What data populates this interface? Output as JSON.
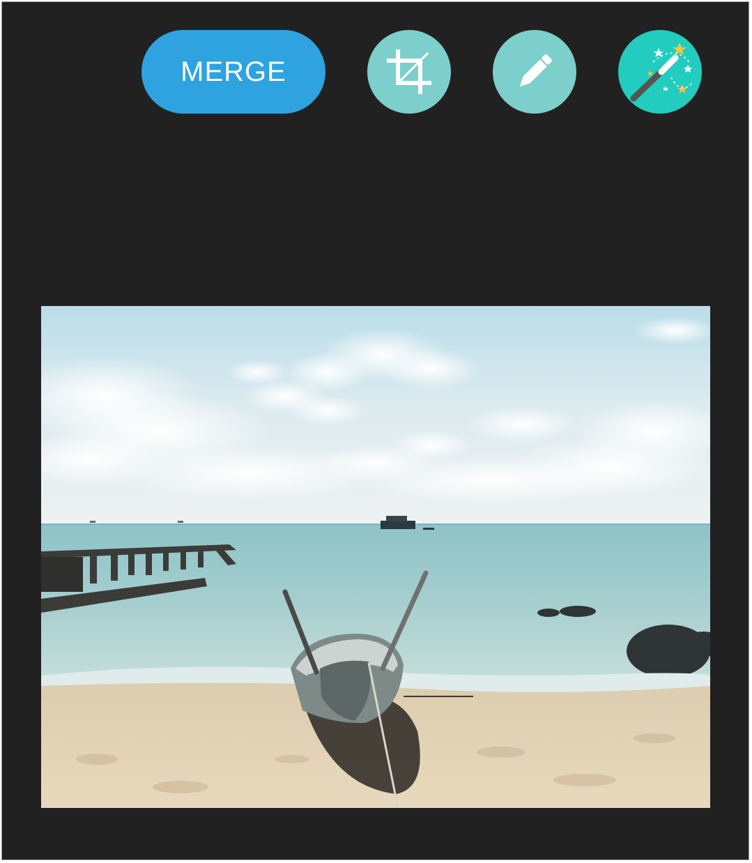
{
  "toolbar": {
    "merge_label": "MERGE",
    "crop_icon": "crop-icon",
    "edit_icon": "pencil-icon",
    "magic_icon": "magic-wand-icon"
  },
  "colors": {
    "background": "#212121",
    "merge_button": "#2ea3e0",
    "tool_button": "#7ccfcb",
    "magic_button": "#22cdc0"
  },
  "photo": {
    "subject": "beach-boat-photo"
  }
}
